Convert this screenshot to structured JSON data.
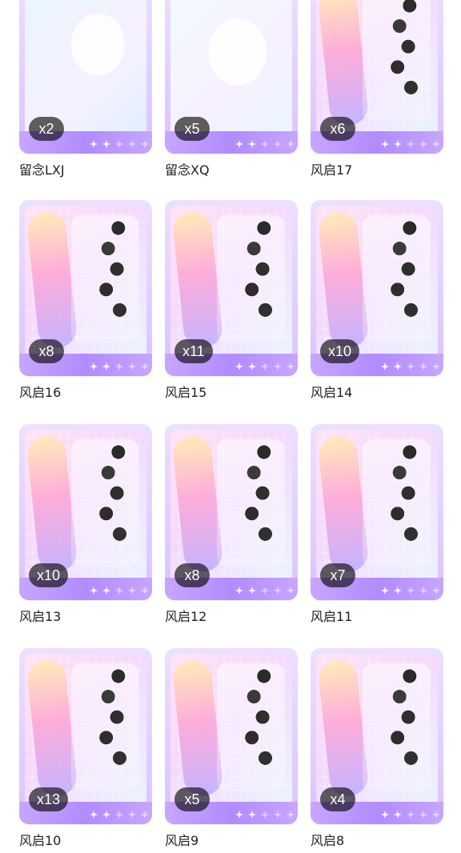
{
  "cards": [
    {
      "badge": "x2",
      "label": "留念LXJ",
      "style": "photo-a"
    },
    {
      "badge": "x5",
      "label": "留念XQ",
      "style": "photo-b"
    },
    {
      "badge": "x6",
      "label": "风启17",
      "style": "group"
    },
    {
      "badge": "x8",
      "label": "风启16",
      "style": "group"
    },
    {
      "badge": "x11",
      "label": "风启15",
      "style": "group"
    },
    {
      "badge": "x10",
      "label": "风启14",
      "style": "group"
    },
    {
      "badge": "x10",
      "label": "风启13",
      "style": "group"
    },
    {
      "badge": "x8",
      "label": "风启12",
      "style": "group"
    },
    {
      "badge": "x7",
      "label": "风启11",
      "style": "group"
    },
    {
      "badge": "x13",
      "label": "风启10",
      "style": "group"
    },
    {
      "badge": "x5",
      "label": "风启9",
      "style": "group"
    },
    {
      "badge": "x4",
      "label": "风启8",
      "style": "group"
    }
  ]
}
